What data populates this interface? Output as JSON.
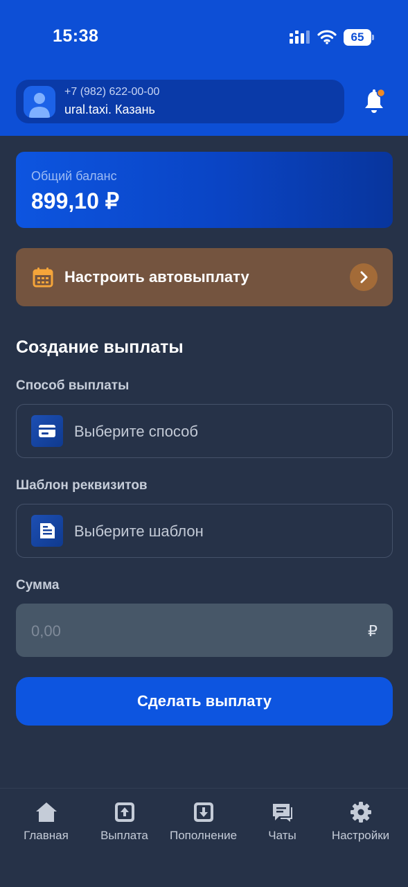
{
  "status_bar": {
    "time": "15:38",
    "battery": "65"
  },
  "profile": {
    "phone": "+7 (982) 622-00-00",
    "company": "ural.taxi. Казань"
  },
  "balance": {
    "label": "Общий баланс",
    "value": "899,10 ₽"
  },
  "autopayout": {
    "label": "Настроить автовыплату"
  },
  "payout_form": {
    "title": "Создание выплаты",
    "method_label": "Способ выплаты",
    "method_placeholder": "Выберите способ",
    "template_label": "Шаблон реквизитов",
    "template_placeholder": "Выберите шаблон",
    "amount_label": "Сумма",
    "amount_placeholder": "0,00",
    "currency": "₽",
    "submit_label": "Сделать выплату"
  },
  "tabbar": {
    "items": [
      {
        "label": "Главная",
        "icon": "home-icon"
      },
      {
        "label": "Выплата",
        "icon": "payout-icon"
      },
      {
        "label": "Пополнение",
        "icon": "top-up-icon"
      },
      {
        "label": "Чаты",
        "icon": "chat-icon"
      },
      {
        "label": "Настройки",
        "icon": "gear-icon"
      }
    ],
    "active_index": 1
  },
  "colors": {
    "header_bg": "#0d4fd6",
    "page_bg": "#263248",
    "accent_blue": "#0d55e0",
    "autopayout_bg": "#74543f",
    "notification_dot": "#f08a24",
    "calendar_icon": "#f5a53a"
  }
}
